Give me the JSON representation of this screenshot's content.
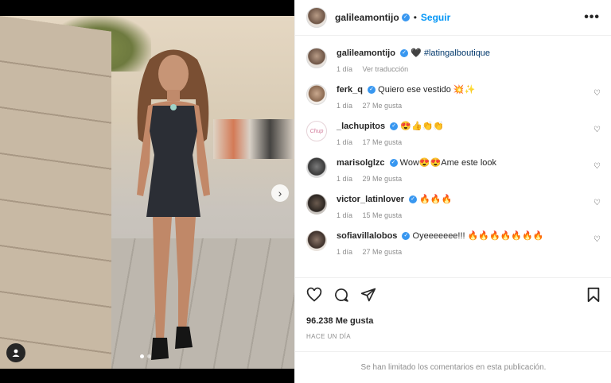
{
  "post": {
    "author": "galileamontijo",
    "follow_label": "Seguir",
    "separator": "•",
    "more_label": "•••",
    "caption_text": "#latingalboutique",
    "caption_heart": "🖤",
    "caption_time": "1 día",
    "translate_label": "Ver traducción"
  },
  "comments": [
    {
      "user": "ferk_q",
      "text": "Quiero ese vestido 💥✨",
      "time": "1 día",
      "likes": "27 Me gusta"
    },
    {
      "user": "_lachupitos",
      "text": "😍👍👏👏",
      "time": "1 día",
      "likes": "17 Me gusta"
    },
    {
      "user": "marisolglzc",
      "text": "Wow😍😍Ame este look",
      "time": "1 día",
      "likes": "29 Me gusta"
    },
    {
      "user": "victor_latinlover",
      "text": "🔥🔥🔥",
      "time": "1 día",
      "likes": "15 Me gusta"
    },
    {
      "user": "sofiavillalobos",
      "text": "Oyeeeeeee!!! 🔥🔥🔥🔥🔥🔥🔥",
      "time": "1 día",
      "likes": "27 Me gusta"
    }
  ],
  "stats": {
    "likes": "96.238 Me gusta",
    "time_ago": "Hace un día"
  },
  "footer": {
    "limited_comments": "Se han limitado los comentarios en esta publicación."
  },
  "icons": {
    "like": "heart-icon",
    "comment": "comment-icon",
    "share": "share-icon",
    "save": "bookmark-icon",
    "next": "chevron-right-icon",
    "tag": "user-tag-icon"
  },
  "colors": {
    "accent": "#0095f6",
    "verified": "#3897f0",
    "meta": "#8e8e8e",
    "text": "#262626"
  }
}
